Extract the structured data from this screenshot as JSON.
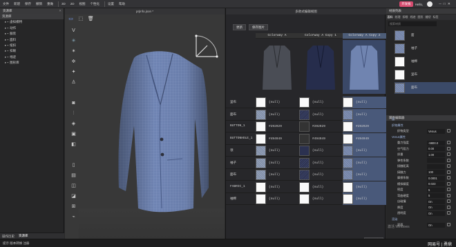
{
  "menu": {
    "items": [
      "文件",
      "新建",
      "保存",
      "撤销",
      "重做",
      "3D",
      "2D",
      "视图",
      "个性化",
      "设置",
      "帮助"
    ]
  },
  "brand": {
    "badge": "开发板",
    "hello": "Hello,"
  },
  "left_panel": {
    "title": "资源库",
    "tree": [
      {
        "label": "资源库",
        "root": true
      },
      {
        "label": "虚拟模特"
      },
      {
        "label": "动作"
      },
      {
        "label": "服装"
      },
      {
        "label": "面料"
      },
      {
        "label": "纽扣"
      },
      {
        "label": "扣眼"
      },
      {
        "label": "线迹"
      },
      {
        "label": "图形库"
      }
    ],
    "tabs": [
      "操作历史",
      "资源库"
    ]
  },
  "status": {
    "text": "提示 版本转换 注册"
  },
  "viewport": {
    "title": "prjInfo.json *"
  },
  "colorway": {
    "title": "多款式编辑视图",
    "buttons": [
      "更新",
      "保存图片"
    ],
    "columns": [
      "Colorway A",
      "Colorway A Copy 1",
      "Colorway A Copy 2"
    ],
    "selected_column": 2,
    "rows": [
      {
        "label": "里布",
        "cells": [
          {
            "sw": "white",
            "v": "(null)"
          },
          {
            "sw": "white",
            "v": "(null)"
          },
          {
            "sw": "white",
            "v": "(null)"
          }
        ]
      },
      {
        "label": "面布",
        "cells": [
          {
            "sw": "tex1",
            "v": "(null)"
          },
          {
            "sw": "tex2",
            "v": "(null)"
          },
          {
            "sw": "tex3",
            "v": "(null)"
          }
        ]
      },
      {
        "label": "BUTTON_1",
        "cells": [
          {
            "sw": "white",
            "v": "#292929"
          },
          {
            "sw": "dark",
            "v": "#292929"
          },
          {
            "sw": "white",
            "v": "#292929"
          }
        ]
      },
      {
        "label": "BUTTONHOLE_1",
        "cells": [
          {
            "sw": "white",
            "v": "#494949"
          },
          {
            "sw": "dark",
            "v": "#494949"
          },
          {
            "sw": "white",
            "v": "#494949"
          }
        ]
      },
      {
        "label": "领",
        "cells": [
          {
            "sw": "tex1",
            "v": "(null)"
          },
          {
            "sw": "navy",
            "v": "(null)"
          },
          {
            "sw": "tex3",
            "v": "(null)"
          }
        ]
      },
      {
        "label": "袖子",
        "cells": [
          {
            "sw": "tex1",
            "v": "(null)"
          },
          {
            "sw": "tex2",
            "v": "(null)"
          },
          {
            "sw": "tex3",
            "v": "(null)"
          }
        ]
      },
      {
        "label": "面布",
        "cells": [
          {
            "sw": "tex1",
            "v": "(null)"
          },
          {
            "sw": "tex2",
            "v": "(null)"
          },
          {
            "sw": "tex3",
            "v": "(null)"
          }
        ]
      },
      {
        "label": "FABRIC_1",
        "cells": [
          {
            "sw": "white",
            "v": "(null)"
          },
          {
            "sw": "white",
            "v": "(null)"
          },
          {
            "sw": "white",
            "v": "(null)"
          }
        ]
      },
      {
        "label": "袖棉",
        "cells": [
          {
            "sw": "white",
            "v": "(null)"
          },
          {
            "sw": "white",
            "v": "(null)"
          },
          {
            "sw": "white",
            "v": "(null)"
          }
        ]
      }
    ],
    "render_button": "图片缩放"
  },
  "right_panel": {
    "title": "材质列表",
    "tabs": [
      "面料",
      "纹理",
      "扣眼",
      "线迹",
      "图形",
      "缝纫",
      "标签"
    ],
    "search_placeholder": "搜索材质",
    "materials": [
      {
        "label": "面",
        "sw": "tex3"
      },
      {
        "label": "袖子",
        "sw": "tex3"
      },
      {
        "label": "袖棉",
        "sw": "white"
      },
      {
        "label": "里布",
        "sw": "white"
      },
      {
        "label": "面布",
        "sw": "tex3",
        "selected": true
      }
    ],
    "property_title": "属性编辑器",
    "properties": [
      {
        "k": "面",
        "sect": true
      },
      {
        "k": "织物属性",
        "sect": true
      },
      {
        "k": "织物类型",
        "v": "Venus"
      },
      {
        "k": "Venus属性",
        "sect": true
      },
      {
        "k": "重力强度",
        "v": "-9800.0"
      },
      {
        "k": "空气阻力",
        "v": "0.00"
      },
      {
        "k": "质量",
        "v": "1.00"
      },
      {
        "k": "弹性系数",
        "v": ""
      },
      {
        "k": "接触距离",
        "v": ""
      },
      {
        "k": "接触力",
        "v": "100"
      },
      {
        "k": "摩擦系数",
        "v": "0.0001"
      },
      {
        "k": "模拟精度",
        "v": "0.023"
      },
      {
        "k": "密度",
        "v": "5"
      },
      {
        "k": "弯曲硬度",
        "v": "5"
      },
      {
        "k": "自碰撞",
        "v": "On"
      },
      {
        "k": "厚度",
        "v": "On"
      },
      {
        "k": "透明度",
        "v": "On"
      },
      {
        "k": "渲染",
        "sect": true
      },
      {
        "k": "双面",
        "v": "On"
      }
    ]
  },
  "watermark": {
    "line1": "激活 Windows",
    "line2": "网易号 | 勇鼎"
  }
}
